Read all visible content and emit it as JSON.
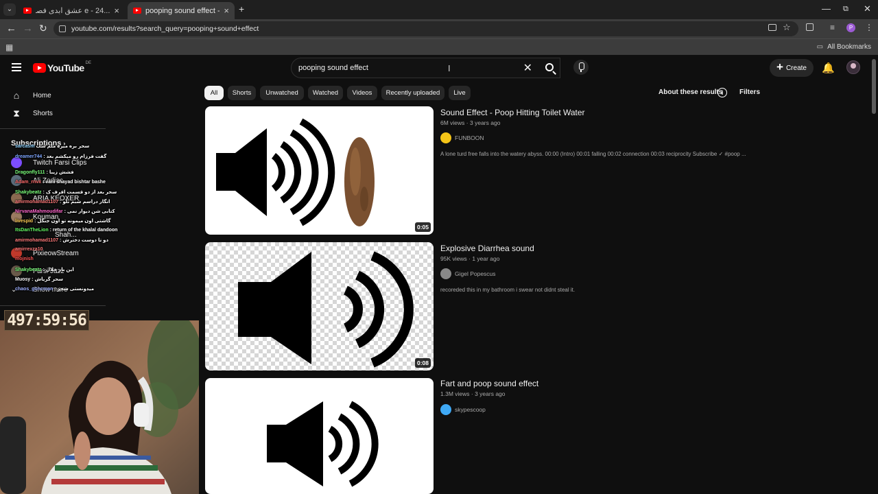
{
  "browser": {
    "tabs": [
      {
        "title": "...e - 24 عشق ابدی فصل 3 قسمت",
        "active": false
      },
      {
        "title": "pooping sound effect - YouTube",
        "active": true
      }
    ],
    "new_tab": "+",
    "url": "youtube.com/results?search_query=pooping+sound+effect",
    "all_bookmarks": "All Bookmarks"
  },
  "youtube": {
    "logo_text": "YouTube",
    "country": "DE",
    "search_value": "pooping sound effect",
    "create_label": "Create",
    "chips": [
      "All",
      "Shorts",
      "Unwatched",
      "Watched",
      "Videos",
      "Recently uploaded",
      "Live"
    ],
    "about": "About these results",
    "filters": "Filters"
  },
  "sidebar": {
    "items": [
      {
        "label": "Home",
        "icon": "home-icon"
      },
      {
        "label": "Shorts",
        "icon": "shorts-icon"
      }
    ],
    "subscriptions_title": "Subscriptions",
    "subscriptions": [
      {
        "name": "Twitch Farsi Clips",
        "color": "#7c4dff"
      },
      {
        "name": "Ali Zodiac",
        "color": "#5a6b7a"
      },
      {
        "name": "ARIA KEOXER",
        "color": "#8a6a50"
      },
      {
        "name": "Kouman",
        "color": "#9a7a60"
      },
      {
        "name": "Shah...",
        "color": "#4a4a4a"
      },
      {
        "name": "PixieowStream",
        "color": "#c0392b"
      },
      {
        "name": "Farsi Jazz",
        "color": "#6a5a4a"
      }
    ],
    "show_more": "Show more"
  },
  "chat": [
    {
      "user": "sarcasm",
      "color": "#8fd3ff",
      "msg": "سحر بره میره ملم شب"
    },
    {
      "user": "dreamer744",
      "color": "#7fa7ff",
      "msg": ": گفت فرزام رو میکشم بعد"
    },
    {
      "user": "Dragonfly111",
      "color": "#7cff7c",
      "msg": ": فشش زیبا"
    },
    {
      "user": "Adam_rnvx",
      "color": "#ff6b6b",
      "msg": ": vani shayad bishtar bashe"
    },
    {
      "user": "Shakybeatz",
      "color": "#7cff7c",
      "msg": ": سحر بعد از دو قسمت اقرف ک"
    },
    {
      "user": "amirmohamad1107",
      "color": "#ff7a7a",
      "msg": ": انگار دراسم شبم تلو"
    },
    {
      "user": "NirvanaMahmoudifar",
      "color": "#ff66cc",
      "msg": ": کتابی شن دیوار نمی"
    },
    {
      "user": "livespid",
      "color": "#ffcc55",
      "msg": ": گاشتی اون میمونه تو اون جنگل"
    },
    {
      "user": "ItsDanTheLion",
      "color": "#66ff66",
      "msg": ": return of the khalal dandoon"
    },
    {
      "user": "amirmohamad1107",
      "color": "#ff7a7a",
      "msg": ": دو تا دوست دخترش"
    },
    {
      "user": "amirrexza10",
      "color": "#ff7a7a",
      "msg": ""
    },
    {
      "user": "mojnish",
      "color": "#ff5555",
      "msg": ""
    },
    {
      "user": "Shakybeatz",
      "color": "#7cff7c",
      "msg": ": این بار خلال"
    },
    {
      "user": "Muosy",
      "color": "#ffffff",
      "msg": ": سحر گریاش"
    },
    {
      "user": "chaos_goncman",
      "color": "#9fb0ff",
      "msg": ": میدونستی سحر"
    }
  ],
  "timer": "497:59:56",
  "results": [
    {
      "title": "Sound Effect - Poop Hitting Toilet Water",
      "views": "6M views",
      "age": "3 years ago",
      "channel": "FUNBOON",
      "channel_color": "#f5c518",
      "description": "A lone turd free falls into the watery abyss. 00:00 (Intro) 00:01 falling 00:02 connection 00:03 reciprocity Subscribe ✓ #poop ...",
      "duration": "0:05",
      "thumb_style": "poop"
    },
    {
      "title": "Explosive Diarrhea sound",
      "views": "95K views",
      "age": "1 year ago",
      "channel": "Gigel Popescus",
      "channel_color": "#888888",
      "description": "recoreded this in my bathroom i swear not didnt steal it.",
      "duration": "0:08",
      "thumb_style": "checker"
    },
    {
      "title": "Fart and poop sound effect",
      "views": "1.3M views",
      "age": "3 years ago",
      "channel": "skypescoop",
      "channel_color": "#3fa9f5",
      "description": "",
      "duration": "",
      "thumb_style": "plain"
    }
  ],
  "icons": {
    "back": "back-arrow-icon",
    "forward": "forward-arrow-icon",
    "reload": "reload-icon",
    "menu": "hamburger-icon",
    "search": "search-icon",
    "mic": "mic-icon",
    "bell": "bell-icon"
  }
}
